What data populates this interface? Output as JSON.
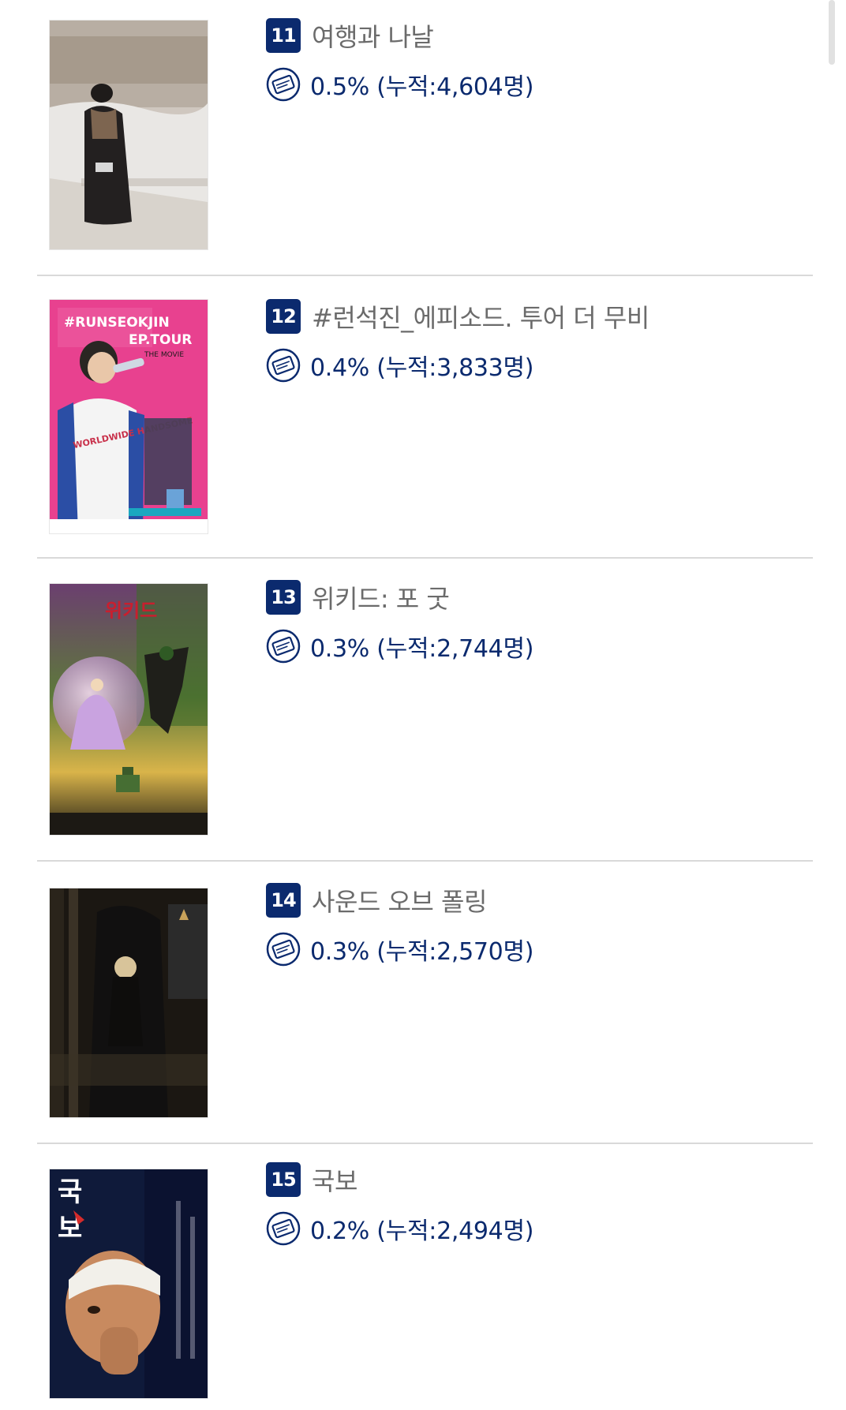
{
  "items": [
    {
      "rank": "11",
      "title": "여행과 나날",
      "stat": "0.5% (누적:4,604명)"
    },
    {
      "rank": "12",
      "title": "#런석진_에피소드. 투어 더 무비",
      "stat": "0.4% (누적:3,833명)",
      "poster_text": [
        "#RUNSEOKJIN",
        "EP.TOUR",
        "THE MOVIE",
        "WORLDWIDE HANDSOME"
      ]
    },
    {
      "rank": "13",
      "title": "위키드: 포 굿",
      "stat": "0.3% (누적:2,744명)",
      "poster_text": [
        "위키드"
      ]
    },
    {
      "rank": "14",
      "title": "사운드 오브 폴링",
      "stat": "0.3% (누적:2,570명)"
    },
    {
      "rank": "15",
      "title": "국보",
      "stat": "0.2% (누적:2,494명)",
      "poster_text": [
        "국",
        "보"
      ]
    }
  ],
  "colors": {
    "rank_bg": "#0b2a6e",
    "stat_text": "#0b2a6e",
    "title_text": "#6b6b6b",
    "divider": "#d9d9d9"
  },
  "icons": {
    "ticket": "ticket-icon"
  }
}
